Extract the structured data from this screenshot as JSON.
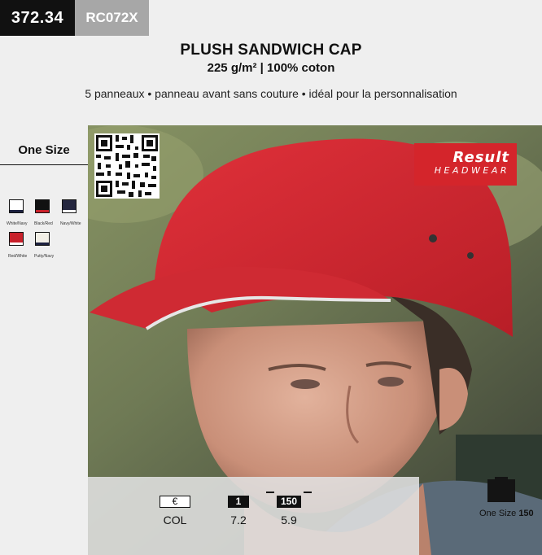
{
  "header": {
    "page_code": "372.34",
    "ref": "RC072X",
    "title": "PLUSH SANDWICH CAP",
    "subtitle": "225 g/m² | 100% coton",
    "description": "5 panneaux • panneau avant sans couture • idéal pour la personnalisation"
  },
  "sizes": {
    "label": "One Size"
  },
  "colors": [
    {
      "label": "White/Navy",
      "top": "#ffffff",
      "bottom": "#1d2240"
    },
    {
      "label": "Black/Red",
      "top": "#111111",
      "bottom": "#c8202a"
    },
    {
      "label": "Navy/White",
      "top": "#24263f",
      "bottom": "#ffffff"
    },
    {
      "label": "Red/White",
      "top": "#c8202a",
      "bottom": "#ffffff"
    },
    {
      "label": "Putty/Navy",
      "top": "#f2efe6",
      "bottom": "#1d2240"
    }
  ],
  "brand": {
    "name": "Result",
    "line": "HEADWEAR",
    "color": "#d4252b"
  },
  "info": {
    "euro_icon": "€",
    "col_label": "COL",
    "box_icon_1": "1",
    "value_1": "7.2",
    "box_icon_150": "150",
    "value_150": "5.9"
  },
  "carton": {
    "size": "One Size",
    "qty": "150"
  }
}
